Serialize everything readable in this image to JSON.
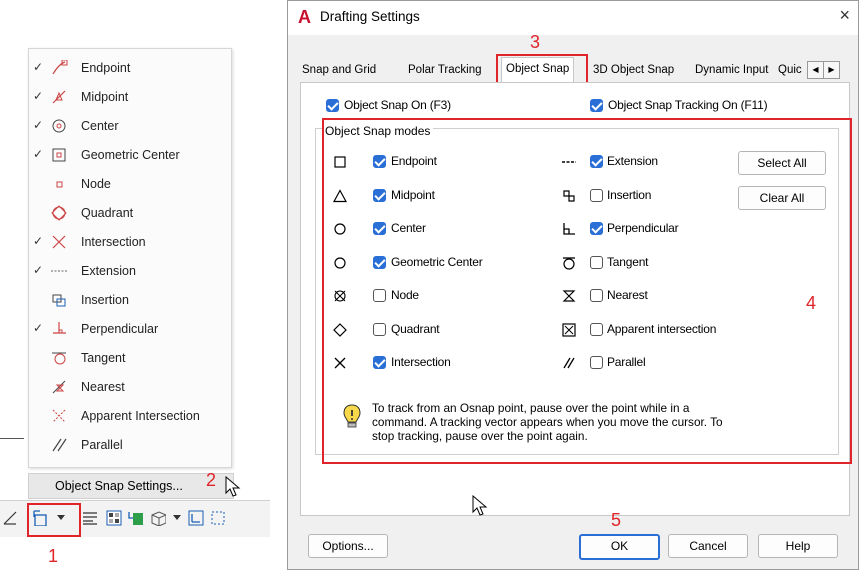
{
  "context_menu": {
    "items": [
      {
        "label": "Endpoint",
        "checked": true,
        "icon": "endpoint-icon"
      },
      {
        "label": "Midpoint",
        "checked": true,
        "icon": "midpoint-icon"
      },
      {
        "label": "Center",
        "checked": true,
        "icon": "center-icon"
      },
      {
        "label": "Geometric Center",
        "checked": true,
        "icon": "geometric-center-icon"
      },
      {
        "label": "Node",
        "checked": false,
        "icon": "node-icon"
      },
      {
        "label": "Quadrant",
        "checked": false,
        "icon": "quadrant-icon"
      },
      {
        "label": "Intersection",
        "checked": true,
        "icon": "intersection-icon"
      },
      {
        "label": "Extension",
        "checked": true,
        "icon": "extension-icon"
      },
      {
        "label": "Insertion",
        "checked": false,
        "icon": "insertion-icon"
      },
      {
        "label": "Perpendicular",
        "checked": true,
        "icon": "perpendicular-icon"
      },
      {
        "label": "Tangent",
        "checked": false,
        "icon": "tangent-icon"
      },
      {
        "label": "Nearest",
        "checked": false,
        "icon": "nearest-icon"
      },
      {
        "label": "Apparent Intersection",
        "checked": false,
        "icon": "apparent-intersection-icon"
      },
      {
        "label": "Parallel",
        "checked": false,
        "icon": "parallel-icon"
      }
    ],
    "settings_label": "Object Snap Settings..."
  },
  "annotations": {
    "n1": "1",
    "n2": "2",
    "n3": "3",
    "n4": "4",
    "n5": "5"
  },
  "dialog": {
    "title": "Drafting Settings",
    "app_icon": "A",
    "close_glyph": "×",
    "tabs": [
      "Snap and Grid",
      "Polar Tracking",
      "Object Snap",
      "3D Object Snap",
      "Dynamic Input",
      "Quic"
    ],
    "active_tab": "Object Snap",
    "snap_on": {
      "label": "Object Snap On (F3)",
      "checked": true
    },
    "tracking_on": {
      "label": "Object Snap Tracking On (F11)",
      "checked": true
    },
    "group_title": "Object Snap modes",
    "left_modes": [
      {
        "label": "Endpoint",
        "checked": true,
        "symbol": "endpoint-symbol"
      },
      {
        "label": "Midpoint",
        "checked": true,
        "symbol": "midpoint-symbol"
      },
      {
        "label": "Center",
        "checked": true,
        "symbol": "center-symbol"
      },
      {
        "label": "Geometric Center",
        "checked": true,
        "symbol": "geometric-center-symbol"
      },
      {
        "label": "Node",
        "checked": false,
        "symbol": "node-symbol"
      },
      {
        "label": "Quadrant",
        "checked": false,
        "symbol": "quadrant-symbol"
      },
      {
        "label": "Intersection",
        "checked": true,
        "symbol": "intersection-symbol"
      }
    ],
    "right_modes": [
      {
        "label": "Extension",
        "checked": true,
        "symbol": "extension-symbol"
      },
      {
        "label": "Insertion",
        "checked": false,
        "symbol": "insertion-symbol"
      },
      {
        "label": "Perpendicular",
        "checked": true,
        "symbol": "perpendicular-symbol"
      },
      {
        "label": "Tangent",
        "checked": false,
        "symbol": "tangent-symbol"
      },
      {
        "label": "Nearest",
        "checked": false,
        "symbol": "nearest-symbol"
      },
      {
        "label": "Apparent intersection",
        "checked": false,
        "symbol": "apparent-intersection-symbol"
      },
      {
        "label": "Parallel",
        "checked": false,
        "symbol": "parallel-symbol"
      }
    ],
    "select_all": "Select All",
    "clear_all": "Clear All",
    "tip_line1": "To track from an Osnap point, pause over the point while in a",
    "tip_line2": "command.  A tracking vector appears when you move the cursor.  To",
    "tip_line3": "stop tracking, pause over the point again.",
    "buttons": {
      "options": "Options...",
      "ok": "OK",
      "cancel": "Cancel",
      "help": "Help"
    }
  },
  "colors": {
    "accent": "#2a6fd6",
    "annotation_red": "#e0242a",
    "autocad_red": "#c8102e"
  }
}
